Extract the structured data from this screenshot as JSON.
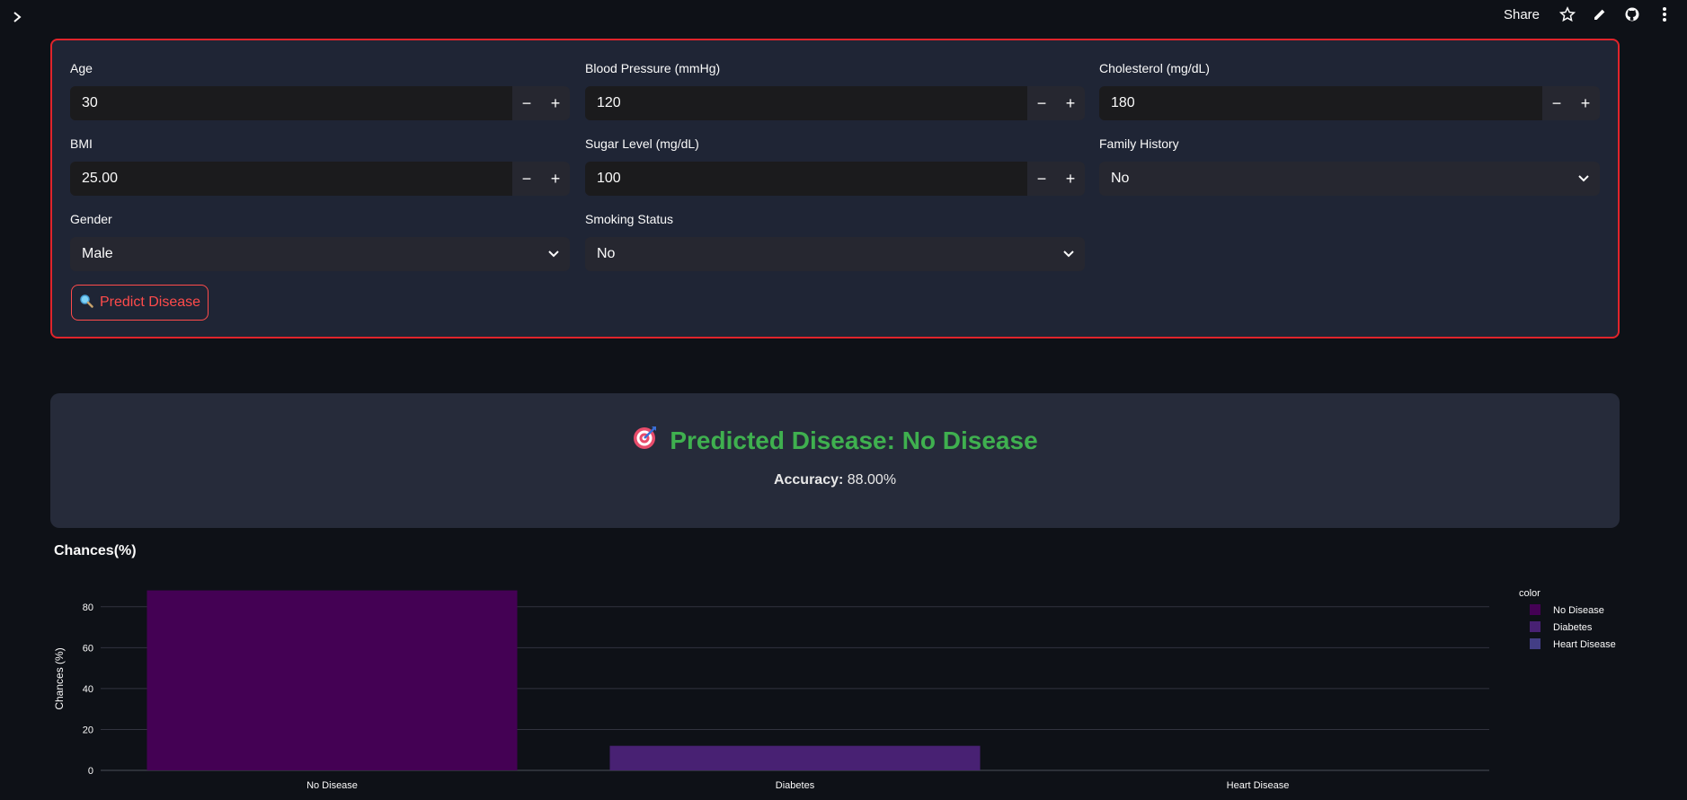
{
  "topbar": {
    "share_label": "Share"
  },
  "form": {
    "age": {
      "label": "Age",
      "value": "30"
    },
    "blood_pressure": {
      "label": "Blood Pressure (mmHg)",
      "value": "120"
    },
    "cholesterol": {
      "label": "Cholesterol (mg/dL)",
      "value": "180"
    },
    "bmi": {
      "label": "BMI",
      "value": "25.00"
    },
    "sugar": {
      "label": "Sugar Level (mg/dL)",
      "value": "100"
    },
    "family_history": {
      "label": "Family History",
      "value": "No"
    },
    "gender": {
      "label": "Gender",
      "value": "Male"
    },
    "smoking": {
      "label": "Smoking Status",
      "value": "No"
    },
    "minus": "−",
    "plus": "+",
    "predict_button": "Predict Disease"
  },
  "result": {
    "title": "Predicted Disease: No Disease",
    "accuracy_label": "Accuracy:",
    "accuracy_value": "88.00%"
  },
  "colors": {
    "accent_red": "#ff4b4b",
    "success_green": "#3fb04f"
  },
  "chart_title": "Chances(%)",
  "chart_data": {
    "type": "bar",
    "categories": [
      "No Disease",
      "Diabetes",
      "Heart Disease"
    ],
    "values": [
      88,
      12,
      0
    ],
    "colors": [
      "#440154",
      "#482173",
      "#433e85"
    ],
    "ylabel": "Chances (%)",
    "xlabel": "",
    "ylim": [
      0,
      90
    ],
    "yticks": [
      0,
      20,
      40,
      60,
      80
    ],
    "legend_title": "color",
    "legend_position": "top-right",
    "grid": true
  }
}
